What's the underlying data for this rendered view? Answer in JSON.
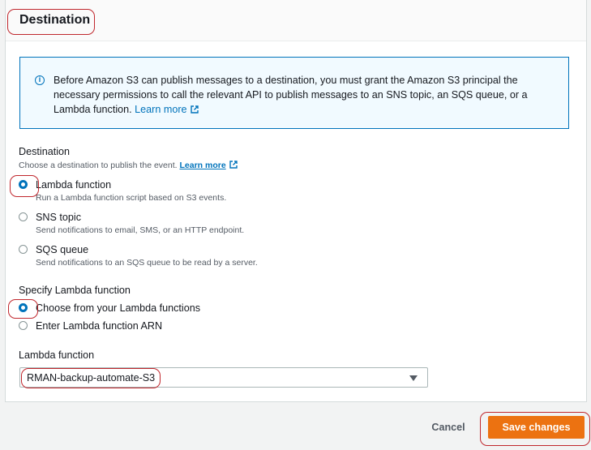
{
  "section": {
    "title": "Destination"
  },
  "info": {
    "text": "Before Amazon S3 can publish messages to a destination, you must grant the Amazon S3 principal the necessary permissions to call the relevant API to publish messages to an SNS topic, an SQS queue, or a Lambda function.",
    "link": "Learn more"
  },
  "destination": {
    "label": "Destination",
    "description": "Choose a destination to publish the event.",
    "link": "Learn more",
    "options": [
      {
        "label": "Lambda function",
        "description": "Run a Lambda function script based on S3 events.",
        "checked": true
      },
      {
        "label": "SNS topic",
        "description": "Send notifications to email, SMS, or an HTTP endpoint.",
        "checked": false
      },
      {
        "label": "SQS queue",
        "description": "Send notifications to an SQS queue to be read by a server.",
        "checked": false
      }
    ]
  },
  "lambda_spec": {
    "label": "Specify Lambda function",
    "options": [
      {
        "label": "Choose from your Lambda functions",
        "checked": true
      },
      {
        "label": "Enter Lambda function ARN",
        "checked": false
      }
    ]
  },
  "lambda_select": {
    "label": "Lambda function",
    "value": "RMAN-backup-automate-S3"
  },
  "footer": {
    "cancel": "Cancel",
    "save": "Save changes"
  },
  "colors": {
    "accent": "#0073bb",
    "primary_button": "#ec7211",
    "annotation": "#c0272d"
  }
}
